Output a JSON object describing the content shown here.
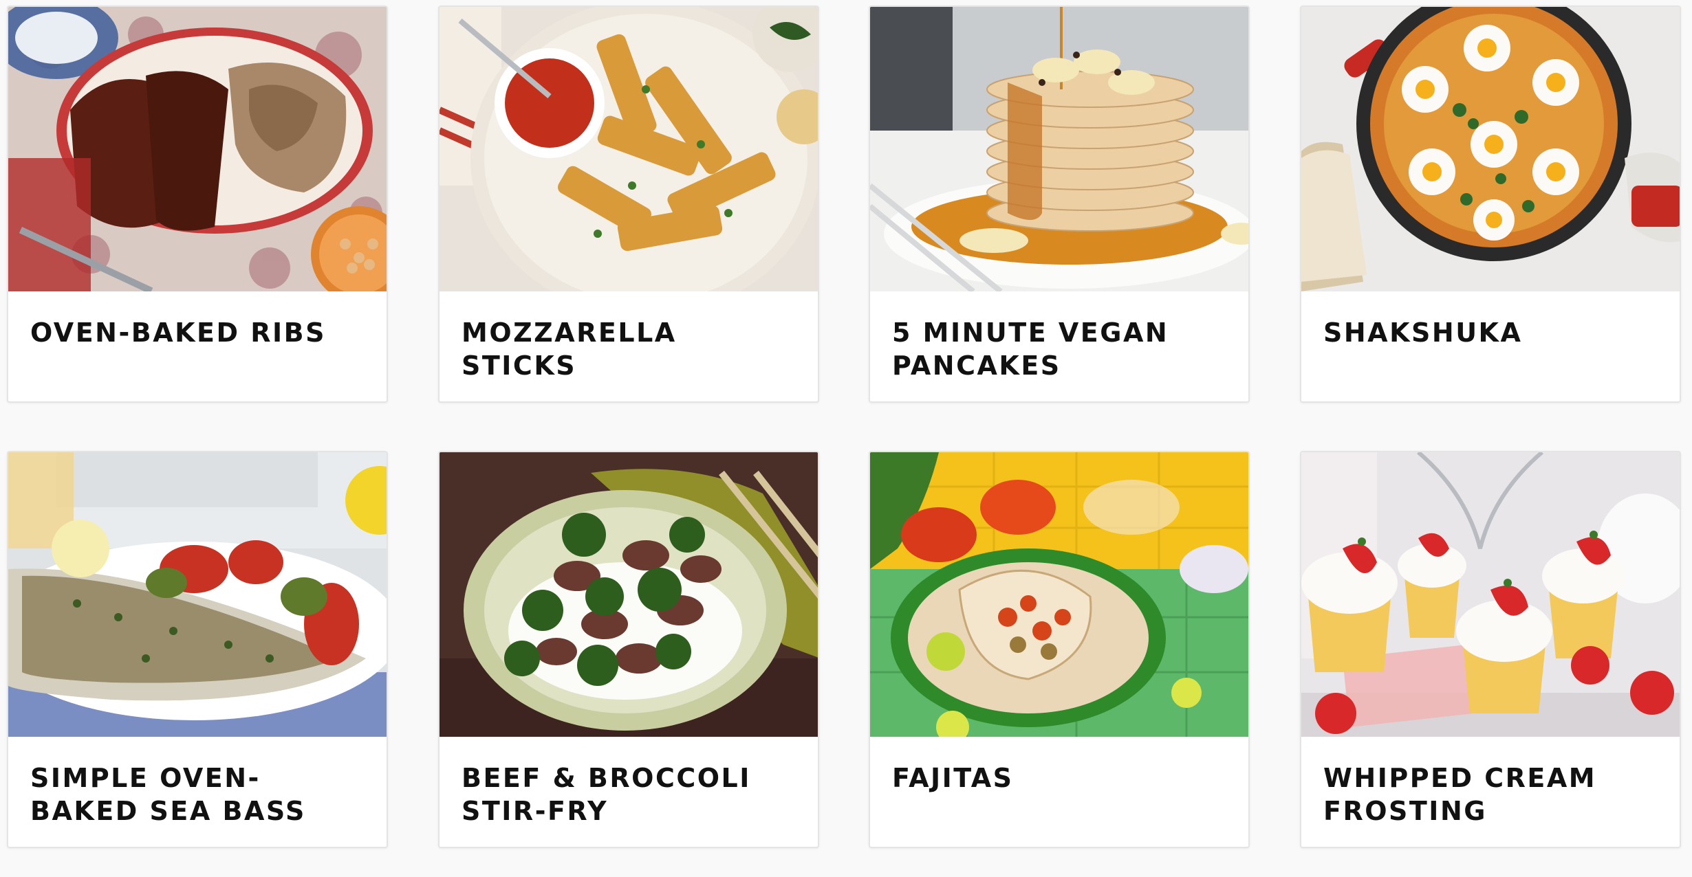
{
  "recipes": [
    {
      "title": "OVEN-BAKED RIBS"
    },
    {
      "title": "MOZZARELLA STICKS"
    },
    {
      "title": "5 MINUTE VEGAN PANCAKES"
    },
    {
      "title": "SHAKSHUKA"
    },
    {
      "title": "SIMPLE OVEN-BAKED SEA BASS"
    },
    {
      "title": "BEEF & BROCCOLI STIR-FRY"
    },
    {
      "title": "FAJITAS"
    },
    {
      "title": "WHIPPED CREAM FROSTING"
    }
  ],
  "colors": {
    "page_background": "#f9f9f9",
    "card_background": "#ffffff",
    "card_border": "#e4e4e4",
    "title_text": "#111111"
  }
}
